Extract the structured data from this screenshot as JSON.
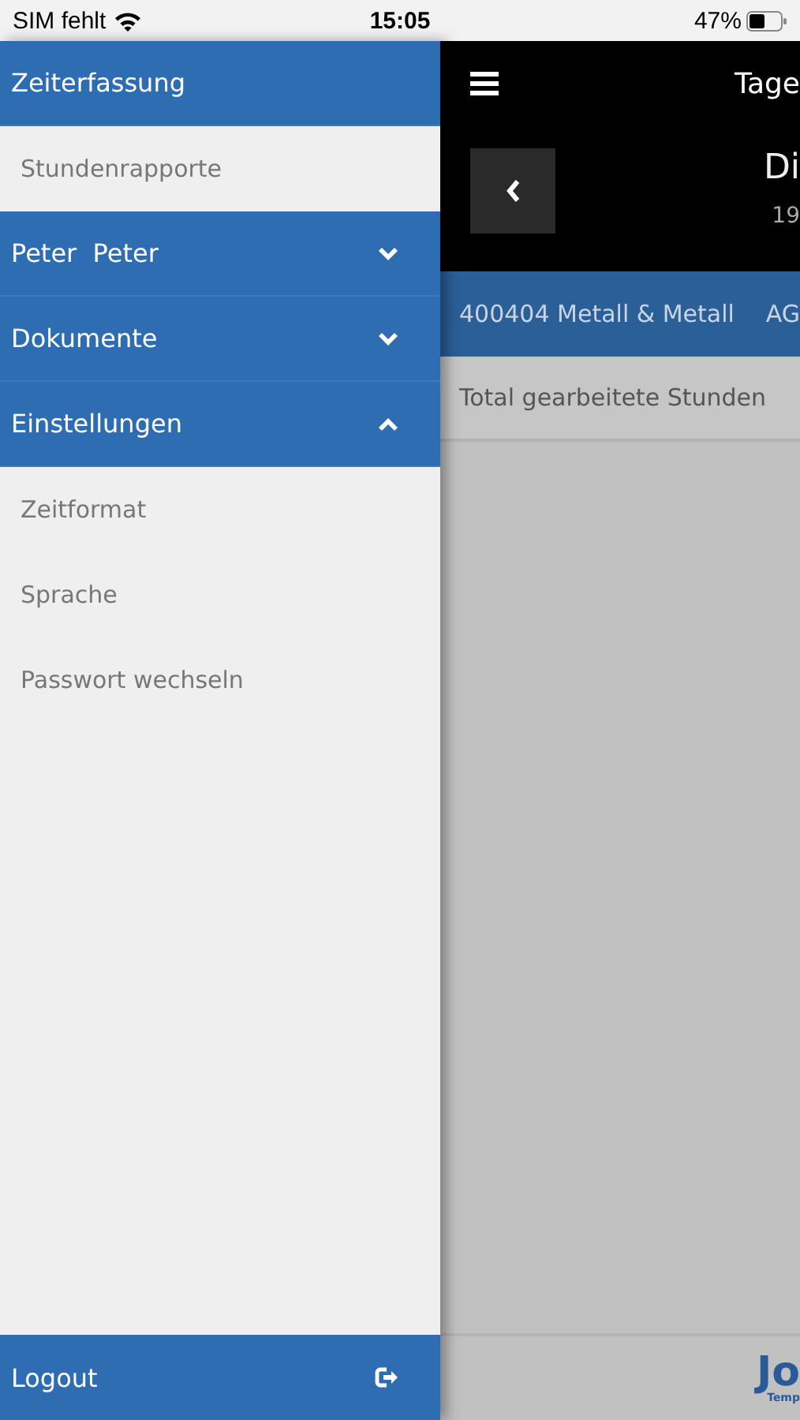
{
  "status_bar": {
    "carrier": "SIM fehlt",
    "time": "15:05",
    "battery": "47%"
  },
  "menu": [
    {
      "label": "Zeiterfassung",
      "kind": "plain",
      "children": [
        {
          "label": "Stundenrapporte"
        }
      ]
    },
    {
      "label": "Peter  Peter",
      "kind": "collapsible",
      "expanded": false
    },
    {
      "label": "Dokumente",
      "kind": "collapsible",
      "expanded": false
    },
    {
      "label": "Einstellungen",
      "kind": "collapsible",
      "expanded": true,
      "children": [
        {
          "label": "Zeitformat"
        },
        {
          "label": "Sprache"
        },
        {
          "label": "Passwort wechseln"
        }
      ]
    }
  ],
  "logout": {
    "label": "Logout"
  },
  "main": {
    "title": "Tage",
    "day": "Di",
    "date": "19",
    "customer": "400404 Metall & Metall",
    "customer_suffix": "AG",
    "total_label": "Total gearbeitete Stunden",
    "logo": "Jo",
    "logo_sub": "Temp"
  }
}
